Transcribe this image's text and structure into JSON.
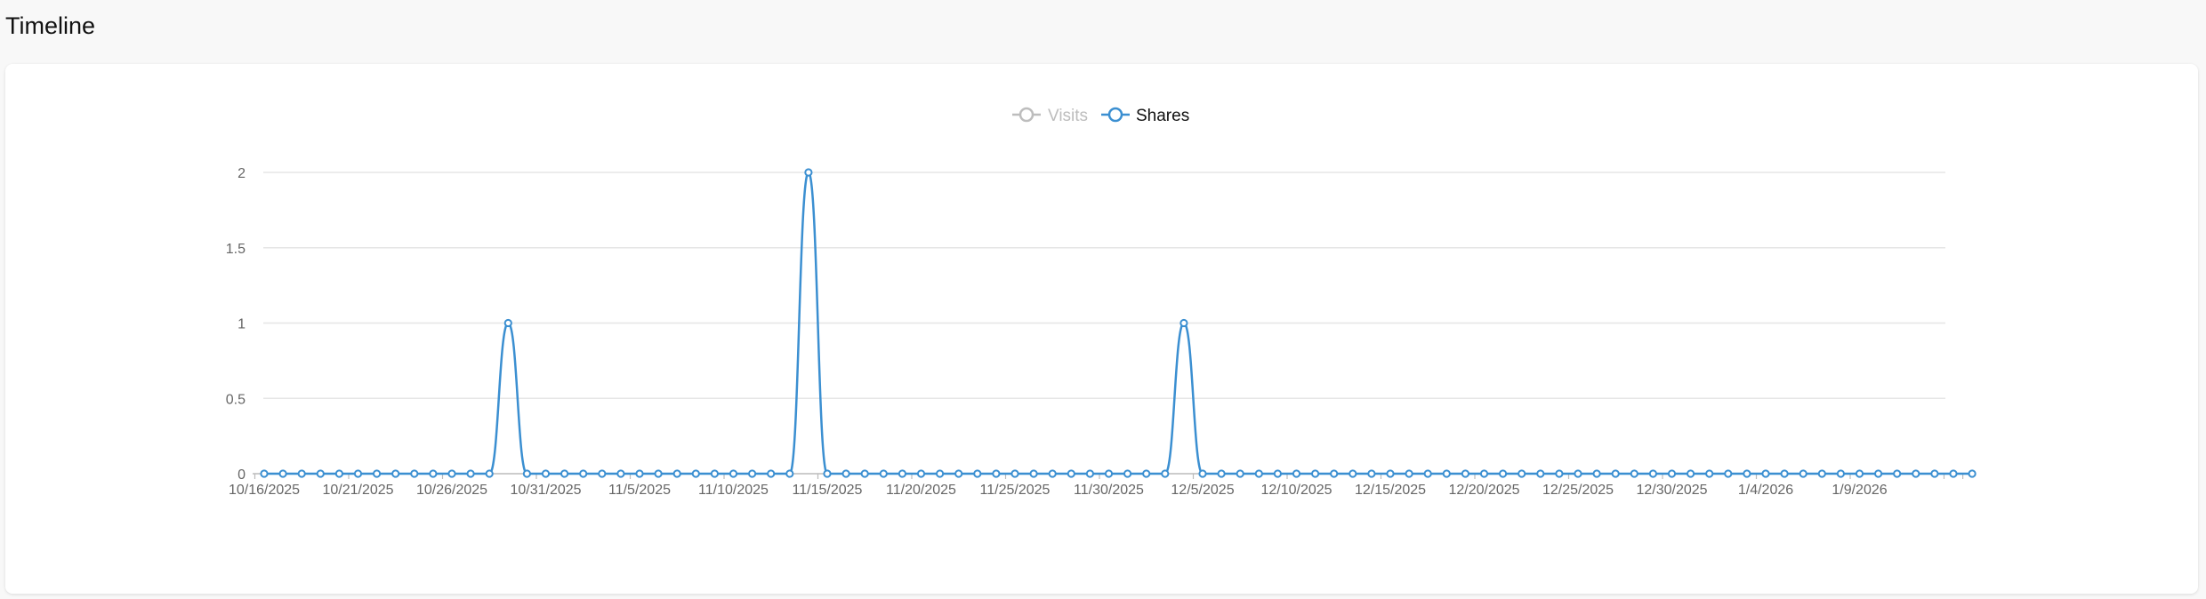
{
  "page": {
    "title": "Timeline"
  },
  "colors": {
    "visits": "#bdbdbd",
    "shares": "#3b8fd1",
    "grid": "#e6e6e6",
    "axis": "#bbbbbb"
  },
  "chart_data": {
    "type": "line",
    "x_start": "2025-10-16",
    "x": [
      "10/16/2025",
      "10/17/2025",
      "10/18/2025",
      "10/19/2025",
      "10/20/2025",
      "10/21/2025",
      "10/22/2025",
      "10/23/2025",
      "10/24/2025",
      "10/25/2025",
      "10/26/2025",
      "10/27/2025",
      "10/28/2025",
      "10/29/2025",
      "10/30/2025",
      "10/31/2025",
      "11/1/2025",
      "11/2/2025",
      "11/3/2025",
      "11/4/2025",
      "11/5/2025",
      "11/6/2025",
      "11/7/2025",
      "11/8/2025",
      "11/9/2025",
      "11/10/2025",
      "11/11/2025",
      "11/12/2025",
      "11/13/2025",
      "11/14/2025",
      "11/15/2025",
      "11/16/2025",
      "11/17/2025",
      "11/18/2025",
      "11/19/2025",
      "11/20/2025",
      "11/21/2025",
      "11/22/2025",
      "11/23/2025",
      "11/24/2025",
      "11/25/2025",
      "11/26/2025",
      "11/27/2025",
      "11/28/2025",
      "11/29/2025",
      "11/30/2025",
      "12/1/2025",
      "12/2/2025",
      "12/3/2025",
      "12/4/2025",
      "12/5/2025",
      "12/6/2025",
      "12/7/2025",
      "12/8/2025",
      "12/9/2025",
      "12/10/2025",
      "12/11/2025",
      "12/12/2025",
      "12/13/2025",
      "12/14/2025",
      "12/15/2025",
      "12/16/2025",
      "12/17/2025",
      "12/18/2025",
      "12/19/2025",
      "12/20/2025",
      "12/21/2025",
      "12/22/2025",
      "12/23/2025",
      "12/24/2025",
      "12/25/2025",
      "12/26/2025",
      "12/27/2025",
      "12/28/2025",
      "12/29/2025",
      "12/30/2025",
      "12/31/2025",
      "1/1/2026",
      "1/2/2026",
      "1/3/2026",
      "1/4/2026",
      "1/5/2026",
      "1/6/2026",
      "1/7/2026",
      "1/8/2026",
      "1/9/2026",
      "1/10/2026",
      "1/11/2026",
      "1/12/2026",
      "1/13/2026",
      "1/14/2026",
      "1/15/2026"
    ],
    "x_tick_labels": [
      "10/16/2025",
      "10/21/2025",
      "10/26/2025",
      "10/31/2025",
      "11/5/2025",
      "11/10/2025",
      "11/15/2025",
      "11/20/2025",
      "11/25/2025",
      "11/30/2025",
      "12/5/2025",
      "12/10/2025",
      "12/15/2025",
      "12/20/2025",
      "12/25/2025",
      "12/30/2025",
      "1/4/2026",
      "1/9/2026"
    ],
    "y_ticks": [
      "0",
      "0.5",
      "1",
      "1.5",
      "2"
    ],
    "ylim": [
      0,
      2
    ],
    "grid": true,
    "legend_position": "top-center",
    "series": [
      {
        "name": "Visits",
        "hidden": true,
        "values": []
      },
      {
        "name": "Shares",
        "hidden": false,
        "values": [
          0,
          0,
          0,
          0,
          0,
          0,
          0,
          0,
          0,
          0,
          0,
          0,
          0,
          1,
          0,
          0,
          0,
          0,
          0,
          0,
          0,
          0,
          0,
          0,
          0,
          0,
          0,
          0,
          0,
          2,
          0,
          0,
          0,
          0,
          0,
          0,
          0,
          0,
          0,
          0,
          0,
          0,
          0,
          0,
          0,
          0,
          0,
          0,
          0,
          1,
          0,
          0,
          0,
          0,
          0,
          0,
          0,
          0,
          0,
          0,
          0,
          0,
          0,
          0,
          0,
          0,
          0,
          0,
          0,
          0,
          0,
          0,
          0,
          0,
          0,
          0,
          0,
          0,
          0,
          0,
          0,
          0,
          0,
          0,
          0,
          0,
          0,
          0,
          0,
          0,
          0,
          0
        ]
      }
    ]
  }
}
